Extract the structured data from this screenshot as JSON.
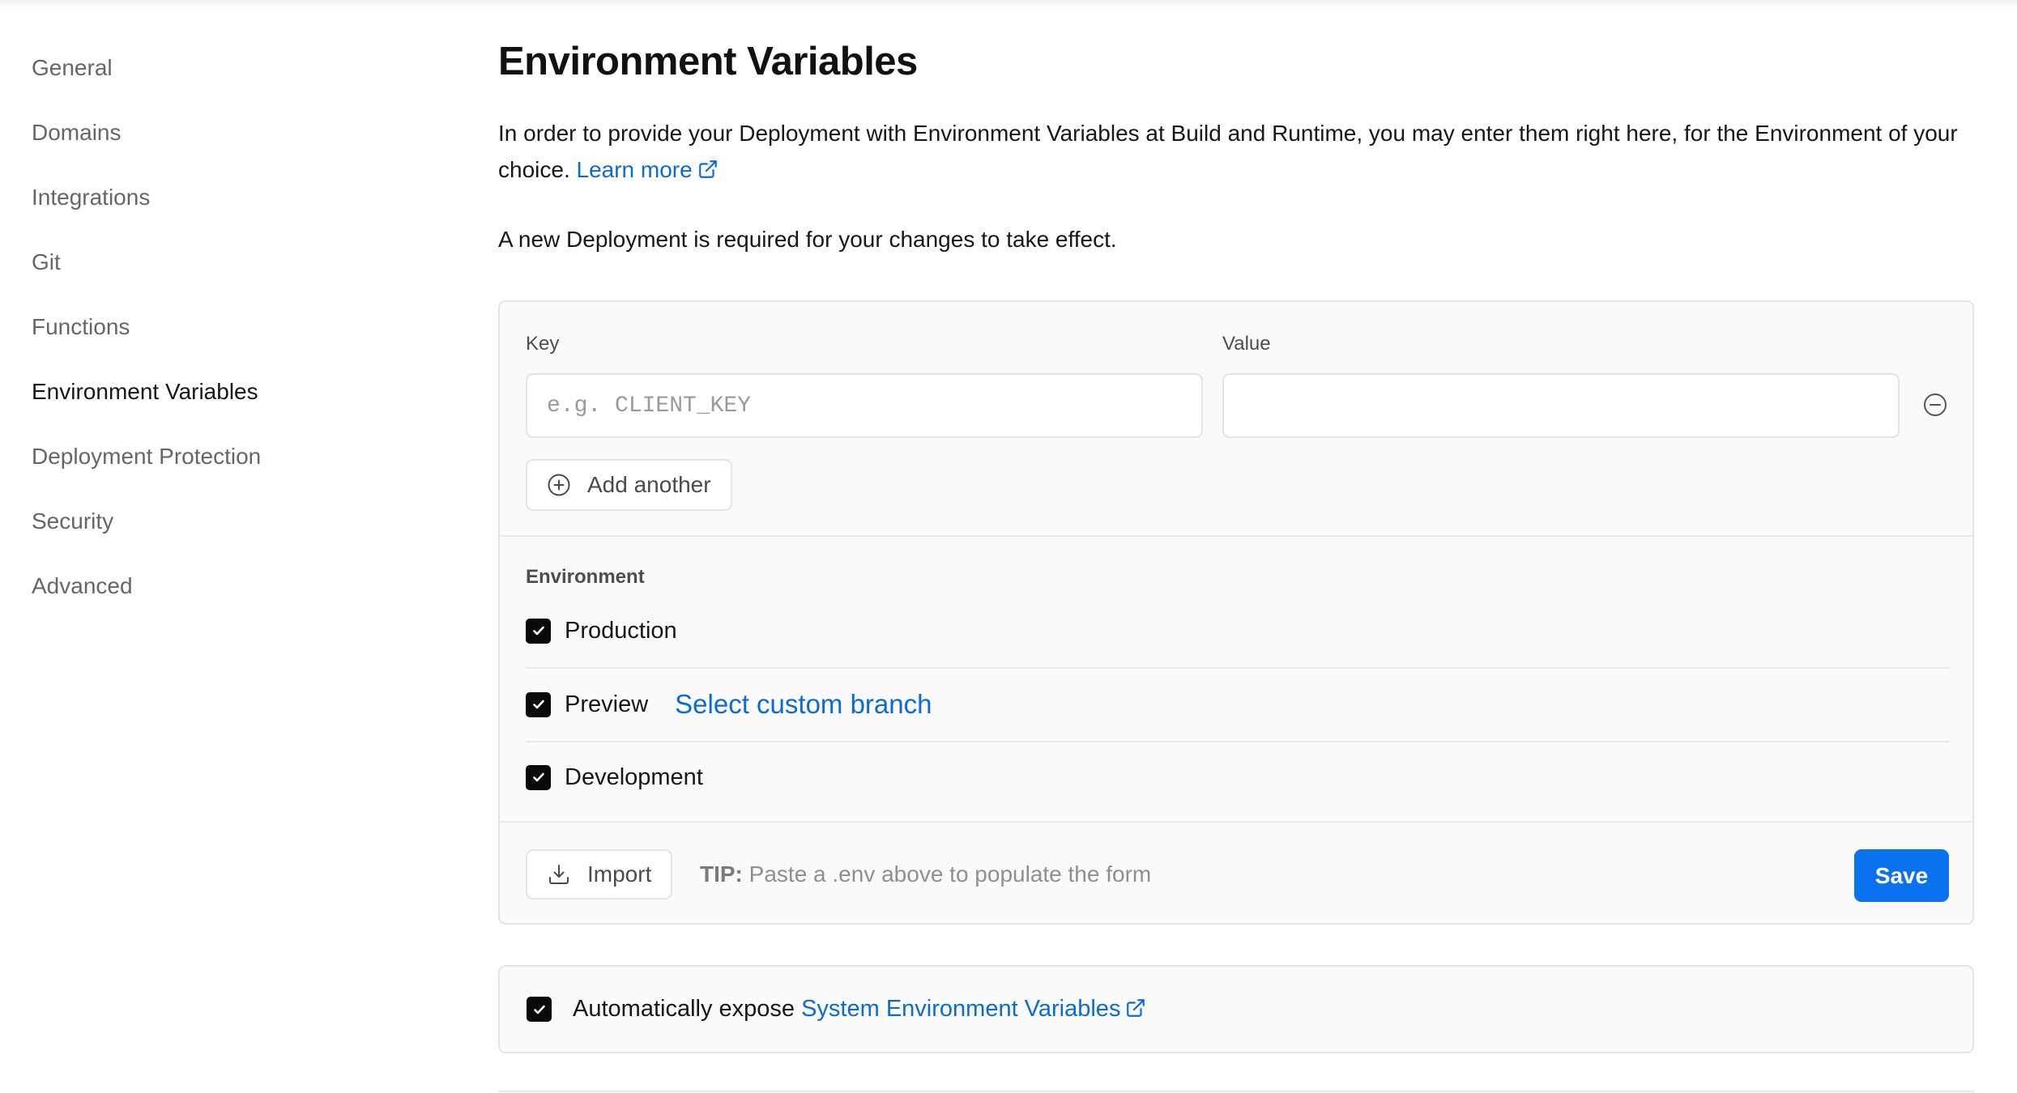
{
  "sidebar": {
    "items": [
      {
        "label": "General",
        "active": false
      },
      {
        "label": "Domains",
        "active": false
      },
      {
        "label": "Integrations",
        "active": false
      },
      {
        "label": "Git",
        "active": false
      },
      {
        "label": "Functions",
        "active": false
      },
      {
        "label": "Environment Variables",
        "active": true
      },
      {
        "label": "Deployment Protection",
        "active": false
      },
      {
        "label": "Security",
        "active": false
      },
      {
        "label": "Advanced",
        "active": false
      }
    ]
  },
  "page": {
    "title": "Environment Variables",
    "intro": "In order to provide your Deployment with Environment Variables at Build and Runtime, you may enter them right here, for the Environment of your choice.",
    "learn_more": "Learn more",
    "note": "A new Deployment is required for your changes to take effect."
  },
  "form": {
    "key_label": "Key",
    "key_placeholder": "e.g. CLIENT_KEY",
    "key_value": "",
    "value_label": "Value",
    "value_value": "",
    "add_another": "Add another",
    "environment_label": "Environment",
    "environments": [
      {
        "label": "Production",
        "checked": true
      },
      {
        "label": "Preview",
        "checked": true,
        "extra_link": "Select custom branch"
      },
      {
        "label": "Development",
        "checked": true
      }
    ],
    "import_label": "Import",
    "tip_prefix": "TIP:",
    "tip_text": "Paste a .env above to populate the form",
    "save_label": "Save"
  },
  "expose": {
    "checked": true,
    "label": "Automatically expose",
    "link": "System Environment Variables"
  },
  "colors": {
    "link": "#0a6bd6",
    "primary_button": "#0a72ef",
    "checkbox": "#0a0a0a"
  }
}
